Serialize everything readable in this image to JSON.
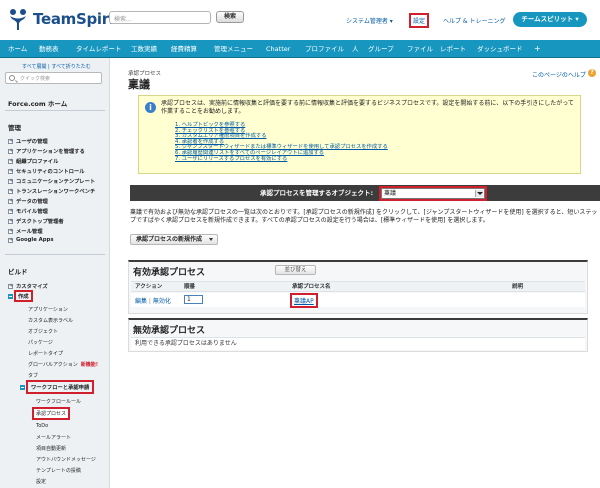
{
  "header": {
    "logo_text": "TeamSpirit",
    "search_placeholder": "検索...",
    "search_button": "検索",
    "system_admin": "システム管理者",
    "settings": "設定",
    "help": "ヘルプ & トレーニング",
    "app_menu": "チームスピリット"
  },
  "tabs": [
    "ホーム",
    "勤務表",
    "タイムレポート",
    "工数実績",
    "経費精算",
    "管理メニュー",
    "Chatter",
    "プロファイル",
    "人",
    "グループ",
    "ファイル",
    "レポート",
    "ダッシュボード",
    "+"
  ],
  "sidebar": {
    "recent": "すべて展開 | すべて折りたたむ",
    "search_placeholder": "クイック検索",
    "home": "Force.com ホーム",
    "admin_heading": "管理",
    "admin_items": [
      "ユーザの管理",
      "アプリケーションを管理する",
      "組織プロファイル",
      "セキュリティのコントロール",
      "コミュニケーションテンプレート",
      "トランスレーションワークベンチ",
      "データの管理",
      "モバイル管理",
      "デスクトップ管理者",
      "メール管理",
      "Google Apps"
    ],
    "build_heading": "ビルド",
    "build_items": [
      "カスタマイズ",
      "作成"
    ],
    "create_items": [
      "アプリケーション",
      "カスタム表示ラベル",
      "オブジェクト",
      "パッケージ",
      "レポートタイプ",
      "グローバルアクション",
      "タブ"
    ],
    "new_badge": "新機能!",
    "workflow": "ワークフローと承認申請",
    "workflow_items": [
      "ワークフロールール",
      "承認プロセス",
      "ToDo",
      "メールアラート",
      "項目自動更新",
      "アウトバウンドメッセージ",
      "テンプレートの投稿",
      "設定"
    ]
  },
  "main": {
    "breadcrumb": "承認プロセス",
    "title": "稟議",
    "help_link": "このページのヘルプ",
    "info_text": "承認プロセスは、実施前に情報収集と評価を要する前に情報収集と評価を要するビジネスプロセスです。設定を開始する前に、以下の手引きにしたがって作業することをお勧めします。",
    "steps": [
      "1.  ヘルプトピックを参照する",
      "2.  チェックリストを参照する",
      "3.  カスタムエリア権限項目を作成する",
      "4.  承認者を作成する",
      "5.  ジャンプスタートウィザードまたは標準ウィザードを使用して承認プロセスを作成する",
      "6.  承認履歴関連リストをすべてのページレイアウトに追加する",
      "7.  ユーザにリリースするプロセスを有効にする"
    ],
    "object_label": "承認プロセスを管理するオブジェクト:",
    "object_value": "稟議",
    "description": "稟議で有効および無効な承認プロセスの一覧は次のとおりです。[承認プロセスの新規作成] をクリックして、[ジャンプスタートウィザードを使用] を選択すると、短いステップですばやく承認プロセスを新規作成できます。すべての承認プロセスの設定を行う場合は、[標準ウィザードを使用] を選択します。",
    "new_button": "承認プロセスの新規作成",
    "active": {
      "title": "有効承認プロセス",
      "reorder": "並び替え",
      "columns": [
        "アクション",
        "順番",
        "承認プロセス名",
        "説明"
      ],
      "row": {
        "edit": "編集",
        "deactivate": "無効化",
        "order": "1",
        "name": "稟議AP",
        "description": ""
      }
    },
    "inactive": {
      "title": "無効承認プロセス",
      "empty": "利用できる承認プロセスはありません"
    }
  },
  "colors": {
    "accent": "#1797c0",
    "highlight": "#d0202e",
    "link": "#015ba7"
  }
}
